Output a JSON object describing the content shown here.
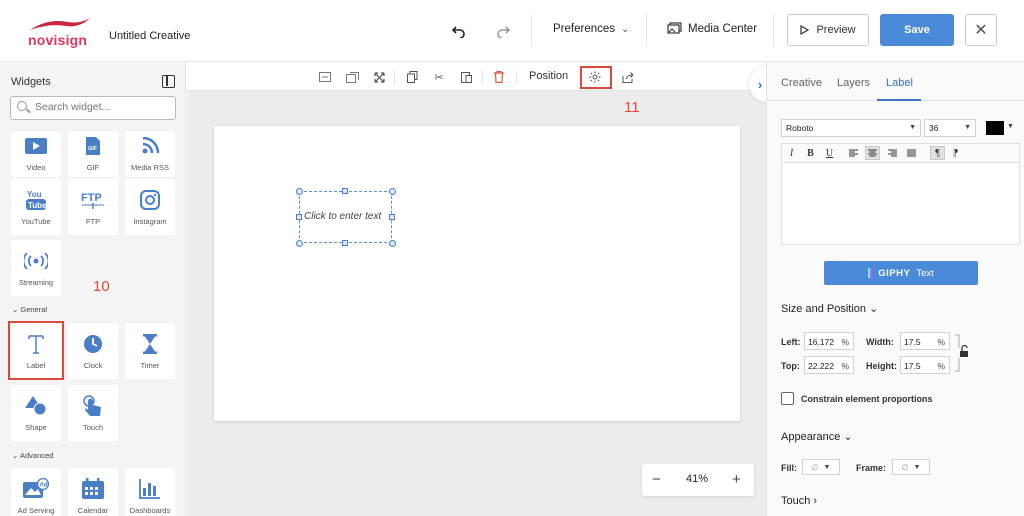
{
  "header": {
    "brand": "novisign",
    "doc_title": "Untitled Creative",
    "preferences_label": "Preferences",
    "media_center_label": "Media Center",
    "preview_label": "Preview",
    "save_label": "Save",
    "close_symbol": "✕"
  },
  "sidebar": {
    "title": "Widgets",
    "search_placeholder": "Search widget...",
    "tiles_top": [
      {
        "label": "Video",
        "icon": "video-icon"
      },
      {
        "label": "GIF",
        "icon": "gif-icon"
      },
      {
        "label": "Media RSS",
        "icon": "rss-icon"
      },
      {
        "label": "YouTube",
        "icon": "youtube-icon"
      },
      {
        "label": "FTP",
        "icon": "ftp-icon"
      },
      {
        "label": "Instagram",
        "icon": "instagram-icon"
      },
      {
        "label": "Streaming",
        "icon": "streaming-icon"
      }
    ],
    "section_general": "General",
    "tiles_general": [
      {
        "label": "Label",
        "icon": "text-icon"
      },
      {
        "label": "Clock",
        "icon": "clock-icon"
      },
      {
        "label": "Timer",
        "icon": "hourglass-icon"
      },
      {
        "label": "Shape",
        "icon": "shape-icon"
      },
      {
        "label": "Touch",
        "icon": "touch-icon"
      }
    ],
    "section_advanced": "Advanced",
    "tiles_advanced": [
      {
        "label": "Ad Serving",
        "icon": "ad-icon"
      },
      {
        "label": "Calendar",
        "icon": "calendar-icon"
      },
      {
        "label": "Dashboards",
        "icon": "bar-chart-icon"
      }
    ]
  },
  "annotations": {
    "step_10": "10",
    "step_11": "11"
  },
  "toolbar": {
    "position_label": "Position"
  },
  "canvas": {
    "label_placeholder": "Click to enter text",
    "zoom_value": "41%",
    "zoom_minus": "−",
    "zoom_plus": "+"
  },
  "right_panel": {
    "tabs": [
      "Creative",
      "Layers",
      "Label"
    ],
    "active_tab": "Label",
    "font_family": "Roboto",
    "font_size": "36",
    "text_color": "#000000",
    "giphy_brand": "GIPHY",
    "giphy_text": "Text",
    "size_position_title": "Size and Position",
    "left_label": "Left:",
    "left_value": "16.172",
    "top_label": "Top:",
    "top_value": "22.222",
    "width_label": "Width:",
    "width_value": "17.5",
    "height_label": "Height:",
    "height_value": "17.5",
    "unit": "%",
    "constrain_label": "Constrain element proportions",
    "appearance_title": "Appearance",
    "fill_label": "Fill:",
    "frame_label": "Frame:",
    "empty_symbol": "∅",
    "touch_title": "Touch"
  },
  "colors": {
    "accent": "#4a8ad8",
    "brand_red": "#e0355e",
    "annotation_red": "#e04a3a"
  }
}
